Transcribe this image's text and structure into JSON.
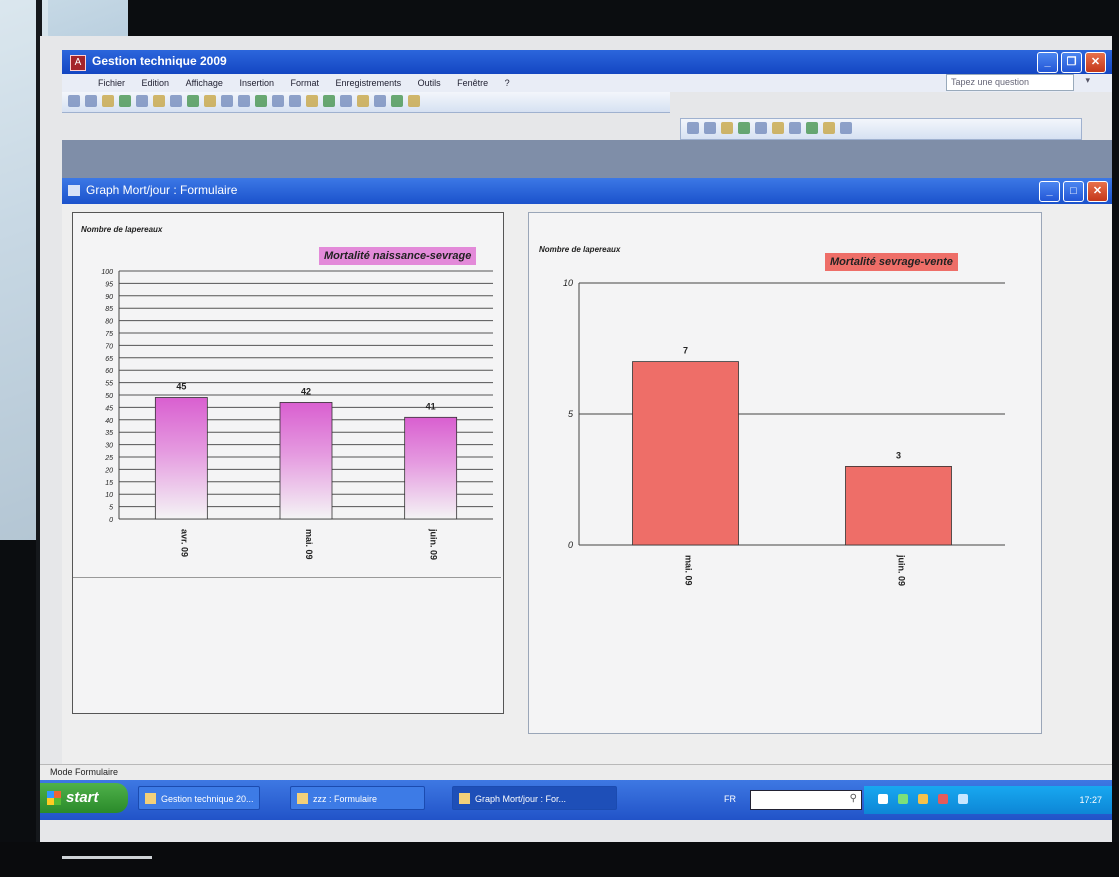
{
  "app": {
    "title": "Gestion technique 2009",
    "menu": [
      "Fichier",
      "Edition",
      "Affichage",
      "Insertion",
      "Format",
      "Enregistrements",
      "Outils",
      "Fenêtre",
      "?"
    ],
    "question_placeholder": "Tapez une question"
  },
  "form": {
    "title": "Graph Mort/jour : Formulaire"
  },
  "status": {
    "text": "Mode Formulaire"
  },
  "taskbar": {
    "start_label": "start",
    "items": [
      "Gestion technique 20...",
      "zzz : Formulaire",
      "Graph Mort/jour : For..."
    ],
    "lang": "FR",
    "clock": "17:27"
  },
  "colors": {
    "pink": "#e38ad9",
    "red": "#ee6e68",
    "xp_blue": "#2153c8"
  },
  "chart_data": [
    {
      "type": "bar",
      "title": "Mortalité naissance-sevrage",
      "ylabel": "Nombre de lapereaux",
      "xlabel": "",
      "categories": [
        "avr. 09",
        "mai. 09",
        "juin. 09"
      ],
      "values": [
        49,
        47,
        41
      ],
      "data_labels": [
        "45",
        "42",
        "41"
      ],
      "ylim": [
        0,
        100
      ],
      "yticks": [
        0,
        5,
        10,
        15,
        20,
        25,
        30,
        35,
        40,
        45,
        50,
        55,
        60,
        65,
        70,
        75,
        80,
        85,
        90,
        95,
        100
      ],
      "grid": true
    },
    {
      "type": "bar",
      "title": "Mortalité sevrage-vente",
      "ylabel": "Nombre de lapereaux",
      "xlabel": "",
      "categories": [
        "mai. 09",
        "juin. 09"
      ],
      "values": [
        7,
        3
      ],
      "data_labels": [
        "7",
        "3"
      ],
      "ylim": [
        0,
        10
      ],
      "yticks": [
        0,
        5,
        10
      ],
      "grid": true
    }
  ]
}
